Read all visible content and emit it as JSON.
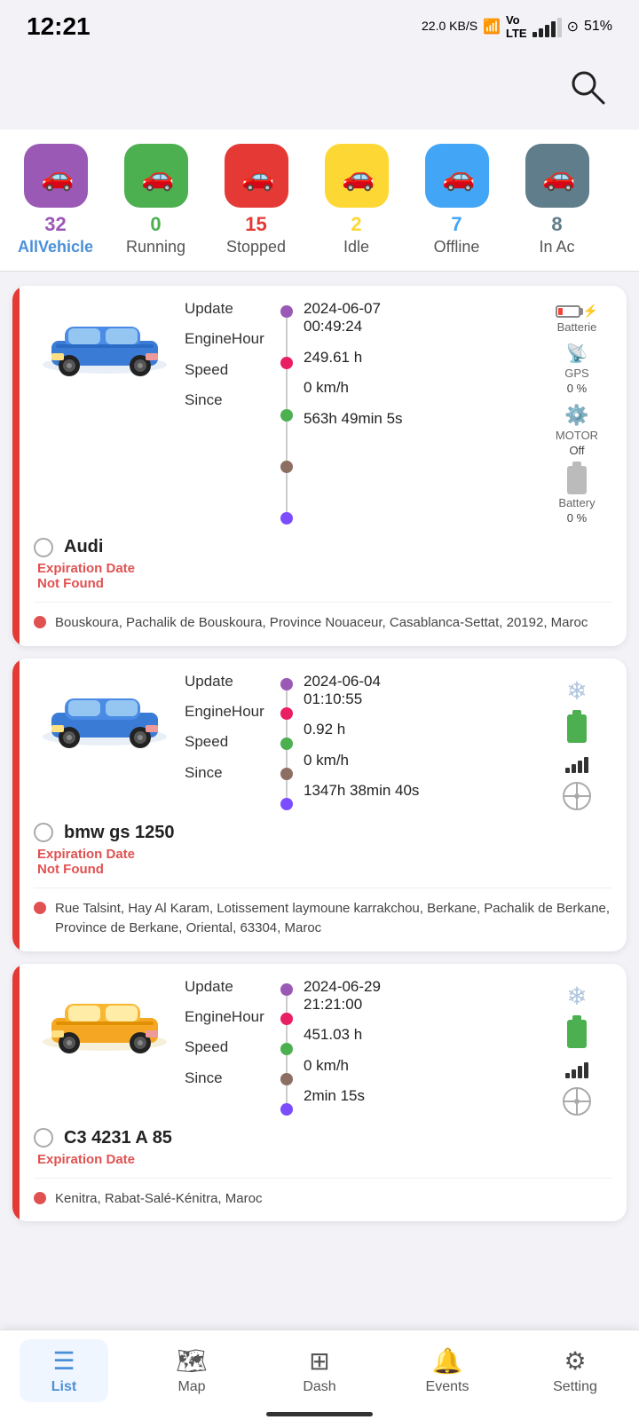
{
  "statusBar": {
    "time": "12:21",
    "network": "22.0 KB/S",
    "battery": "51%"
  },
  "filterTabs": [
    {
      "id": "all",
      "count": "32",
      "label": "AllVehicle",
      "color": "#9b59b6",
      "active": true
    },
    {
      "id": "running",
      "count": "0",
      "label": "Running",
      "color": "#4caf50",
      "active": false
    },
    {
      "id": "stopped",
      "count": "15",
      "label": "Stopped",
      "color": "#e53935",
      "active": false
    },
    {
      "id": "idle",
      "count": "2",
      "label": "Idle",
      "color": "#fdd835",
      "active": false
    },
    {
      "id": "offline",
      "count": "7",
      "label": "Offline",
      "color": "#42a5f5",
      "active": false
    },
    {
      "id": "inac",
      "count": "8",
      "label": "In Ac",
      "color": "#607d8b",
      "active": false
    }
  ],
  "vehicles": [
    {
      "name": "Audi",
      "carColor": "blue",
      "leftBarColor": "#e53935",
      "expiry": "Expiration Date\nNot Found",
      "update": "2024-06-07\n00:49:24",
      "engineHour": "249.61 h",
      "speed": "0 km/h",
      "since": "563h 49min 5s",
      "batterie": "Batterie",
      "gps": "GPS",
      "gpsValue": "0 %",
      "motor": "MOTOR",
      "motorValue": "Off",
      "battery": "Battery",
      "batteryValue": "0 %",
      "address": "Bouskoura, Pachalik de Bouskoura, Province Nouaceur, Casablanca-Settat, 20192, Maroc"
    },
    {
      "name": "bmw gs\n1250",
      "carColor": "blue",
      "leftBarColor": "#e53935",
      "expiry": "Expiration Date\nNot Found",
      "update": "2024-06-04\n01:10:55",
      "engineHour": "0.92 h",
      "speed": "0 km/h",
      "since": "1347h 38min\n40s",
      "address": "Rue Talsint, Hay Al Karam, Lotissement laymoune karrakchou, Berkane, Pachalik de Berkane, Province de Berkane, Oriental, 63304, Maroc"
    },
    {
      "name": "C3 4231 A\n85",
      "carColor": "yellow",
      "leftBarColor": "#e53935",
      "expiry": "Expiration Date",
      "update": "2024-06-29\n21:21:00",
      "engineHour": "451.03 h",
      "speed": "0 km/h",
      "since": "2min 15s",
      "address": "Kenitra, Rabat-Salé-Kénitra, Maroc"
    }
  ],
  "bottomNav": [
    {
      "id": "list",
      "label": "List",
      "active": true
    },
    {
      "id": "map",
      "label": "Map",
      "active": false
    },
    {
      "id": "dash",
      "label": "Dash",
      "active": false
    },
    {
      "id": "events",
      "label": "Events",
      "active": false
    },
    {
      "id": "setting",
      "label": "Setting",
      "active": false
    }
  ]
}
